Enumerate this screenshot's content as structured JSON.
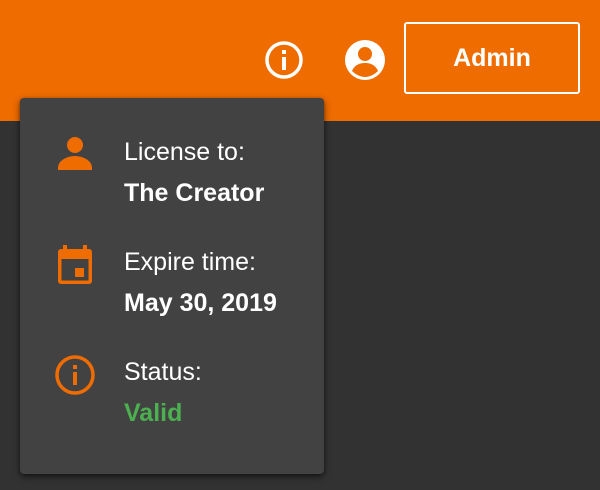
{
  "header": {
    "info_icon": "info-outline-icon",
    "account_icon": "account-circle-icon",
    "admin_label": "Admin",
    "accent_color": "#ef6c00"
  },
  "license_popover": {
    "license": {
      "icon": "person-icon",
      "label": "License to:",
      "value": "The Creator"
    },
    "expire": {
      "icon": "calendar-icon",
      "label": "Expire time:",
      "value": "May 30, 2019"
    },
    "status": {
      "icon": "info-outline-icon",
      "label": "Status:",
      "value": "Valid",
      "value_color": "#4caf50"
    }
  }
}
